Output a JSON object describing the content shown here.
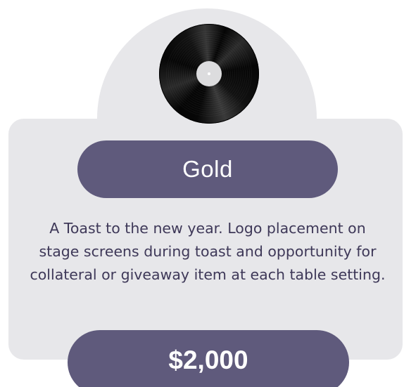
{
  "tier": {
    "name": "Gold",
    "description": "A Toast to the new year. Logo placement on stage screens during toast and opportunity for collateral or giveaway item at each table setting.",
    "price": "$2,000"
  },
  "icon": "vinyl-record-icon",
  "colors": {
    "card_bg": "#e7e7ea",
    "pill_bg": "#5f5a7c",
    "pill_text": "#ffffff",
    "body_text": "#3e3858"
  }
}
